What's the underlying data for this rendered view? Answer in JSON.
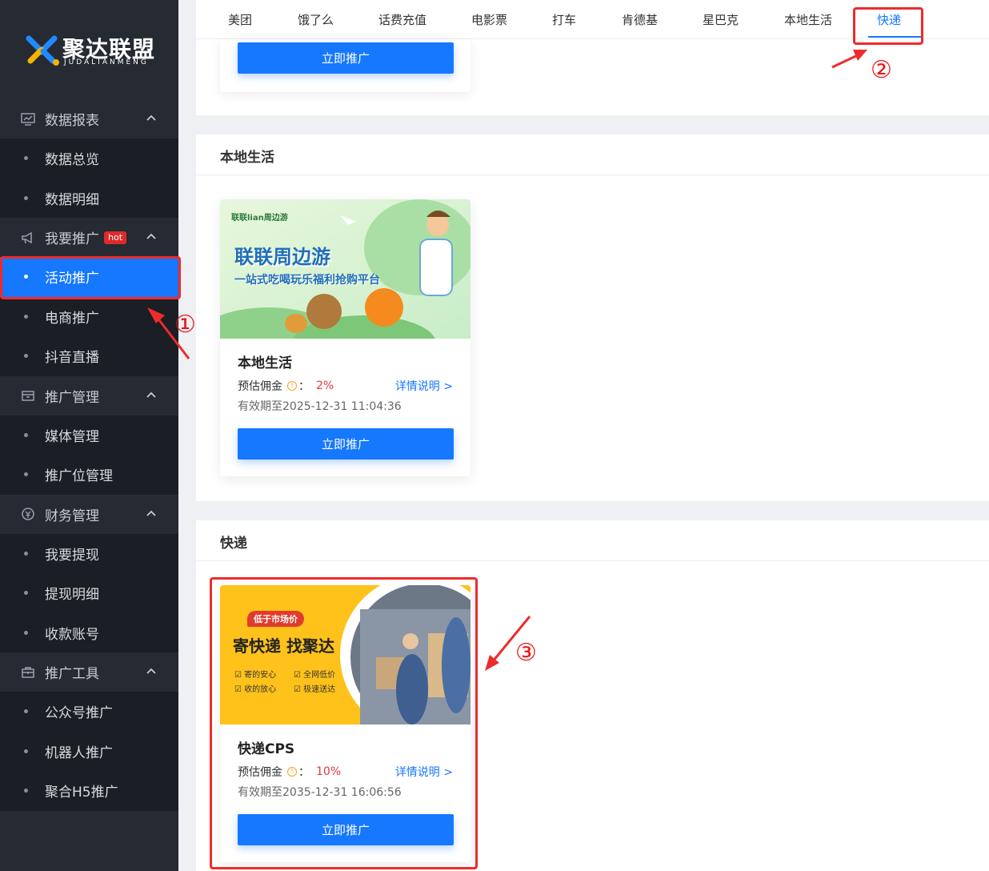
{
  "brand": {
    "name": "聚达联盟",
    "subtitle": "JUDALIANMENG"
  },
  "sidebar": {
    "groups": [
      {
        "label": "数据报表",
        "icon": "monitor-chart-icon",
        "items": [
          "数据总览",
          "数据明细"
        ]
      },
      {
        "label": "我要推广",
        "icon": "megaphone-icon",
        "badge": "hot",
        "items": [
          "活动推广",
          "电商推广",
          "抖音直播"
        ]
      },
      {
        "label": "推广管理",
        "icon": "archive-box-icon",
        "items": [
          "媒体管理",
          "推广位管理"
        ]
      },
      {
        "label": "财务管理",
        "icon": "money-icon",
        "items": [
          "我要提现",
          "提现明细",
          "收款账号"
        ]
      },
      {
        "label": "推广工具",
        "icon": "toolbox-icon",
        "items": [
          "公众号推广",
          "机器人推广",
          "聚合H5推广"
        ]
      }
    ],
    "active_item": "活动推广"
  },
  "tabs": [
    "美团",
    "饿了么",
    "话费充值",
    "电影票",
    "打车",
    "肯德基",
    "星巴克",
    "本地生活",
    "快递"
  ],
  "active_tab": "快递",
  "promote_button": "立即推广",
  "sections": {
    "local": {
      "title": "本地生活",
      "card": {
        "title": "本地生活",
        "commission_label": "预估佣金",
        "colon": "：",
        "commission": "2%",
        "detail": "详情说明 >",
        "valid": "有效期至2025-12-31 11:04:36",
        "banner": {
          "logo": "联联lian周边游",
          "headline": "联联周边游",
          "slogan": "一站式吃喝玩乐福利抢购平台"
        }
      }
    },
    "express": {
      "title": "快递",
      "card": {
        "title": "快递CPS",
        "commission_label": "预估佣金",
        "colon": "：",
        "commission": "10%",
        "detail": "详情说明 >",
        "valid": "有效期至2035-12-31 16:06:56",
        "banner": {
          "tag": "低于市场价",
          "headline": "寄快递 找聚达",
          "features": [
            "寄的安心",
            "全网低价",
            "收的放心",
            "极速送达"
          ]
        }
      }
    }
  },
  "annotations": [
    "①",
    "②",
    "③"
  ],
  "colors": {
    "accent": "#1677ff",
    "sidebar_bg": "#262a33",
    "annotation": "#ee2b2b",
    "commission": "#e53935"
  }
}
